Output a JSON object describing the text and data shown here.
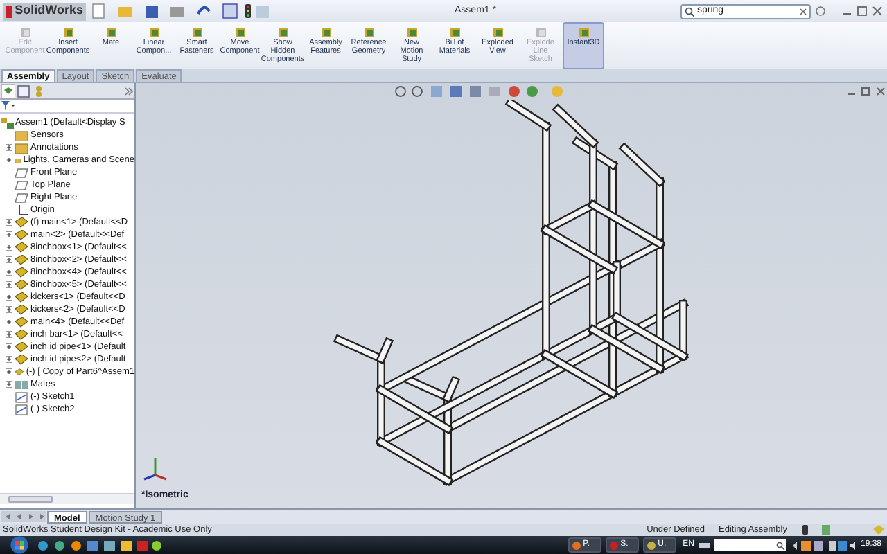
{
  "window": {
    "app_name": "SolidWorks",
    "title": "Assem1 *",
    "search": {
      "value": "spring"
    }
  },
  "ribbon": [
    {
      "label": "Edit Component",
      "disabled": true,
      "selected": false
    },
    {
      "label": "Insert Components",
      "disabled": false,
      "selected": false
    },
    {
      "label": "Mate",
      "disabled": false,
      "selected": false
    },
    {
      "label": "Linear Compon...",
      "disabled": false,
      "selected": false
    },
    {
      "label": "Smart Fasteners",
      "disabled": false,
      "selected": false
    },
    {
      "label": "Move Component",
      "disabled": false,
      "selected": false
    },
    {
      "label": "Show Hidden Components",
      "disabled": false,
      "selected": false
    },
    {
      "label": "Assembly Features",
      "disabled": false,
      "selected": false
    },
    {
      "label": "Reference Geometry",
      "disabled": false,
      "selected": false
    },
    {
      "label": "New Motion Study",
      "disabled": false,
      "selected": false
    },
    {
      "label": "Bill of Materials",
      "disabled": false,
      "selected": false
    },
    {
      "label": "Exploded View",
      "disabled": false,
      "selected": false
    },
    {
      "label": "Explode Line Sketch",
      "disabled": true,
      "selected": false
    },
    {
      "label": "Instant3D",
      "disabled": false,
      "selected": true
    }
  ],
  "tabs": [
    {
      "label": "Assembly",
      "selected": true
    },
    {
      "label": "Layout",
      "selected": false
    },
    {
      "label": "Sketch",
      "selected": false
    },
    {
      "label": "Evaluate",
      "selected": false
    }
  ],
  "tree": {
    "label": "Assem1  (Default<Display S",
    "kind": "assembly",
    "children": [
      {
        "label": "Sensors",
        "kind": "folder"
      },
      {
        "label": "Annotations",
        "kind": "folder",
        "expanded": false
      },
      {
        "label": "Lights, Cameras and Scene",
        "kind": "folder",
        "expanded": false
      },
      {
        "label": "Front Plane",
        "kind": "plane"
      },
      {
        "label": "Top Plane",
        "kind": "plane"
      },
      {
        "label": "Right Plane",
        "kind": "plane"
      },
      {
        "label": "Origin",
        "kind": "origin"
      },
      {
        "label": "(f) main<1> (Default<<D",
        "kind": "part",
        "expanded": false
      },
      {
        "label": "main<2> (Default<<Def",
        "kind": "part",
        "expanded": false
      },
      {
        "label": "8inchbox<1> (Default<<",
        "kind": "part",
        "expanded": false
      },
      {
        "label": "8inchbox<2> (Default<<",
        "kind": "part",
        "expanded": false
      },
      {
        "label": "8inchbox<4> (Default<<",
        "kind": "part",
        "expanded": false
      },
      {
        "label": "8inchbox<5> (Default<<",
        "kind": "part",
        "expanded": false
      },
      {
        "label": "kickers<1> (Default<<D",
        "kind": "part",
        "expanded": false
      },
      {
        "label": "kickers<2> (Default<<D",
        "kind": "part",
        "expanded": false
      },
      {
        "label": "main<4> (Default<<Def",
        "kind": "part",
        "expanded": false
      },
      {
        "label": "inch bar<1> (Default<<",
        "kind": "part",
        "expanded": false
      },
      {
        "label": "inch id pipe<1> (Default",
        "kind": "part",
        "expanded": false
      },
      {
        "label": "inch id pipe<2> (Default",
        "kind": "part",
        "expanded": false
      },
      {
        "label": "(-) [ Copy of Part6^Assem1",
        "kind": "part",
        "expanded": false
      },
      {
        "label": "Mates",
        "kind": "mates",
        "expanded": false
      },
      {
        "label": "(-) Sketch1",
        "kind": "sketch"
      },
      {
        "label": "(-) Sketch2",
        "kind": "sketch"
      }
    ]
  },
  "viewport": {
    "view_label": "*Isometric"
  },
  "bottom_tabs": [
    {
      "label": "Model",
      "selected": true
    },
    {
      "label": "Motion Study 1",
      "selected": false
    }
  ],
  "status_bar": {
    "left": "SolidWorks Student Design Kit - Academic Use Only",
    "items": [
      "Under Defined",
      "Editing Assembly"
    ]
  },
  "taskbar": {
    "tasks": [
      "P.",
      "S.",
      "U."
    ],
    "language": "EN",
    "clock": "19:38"
  }
}
